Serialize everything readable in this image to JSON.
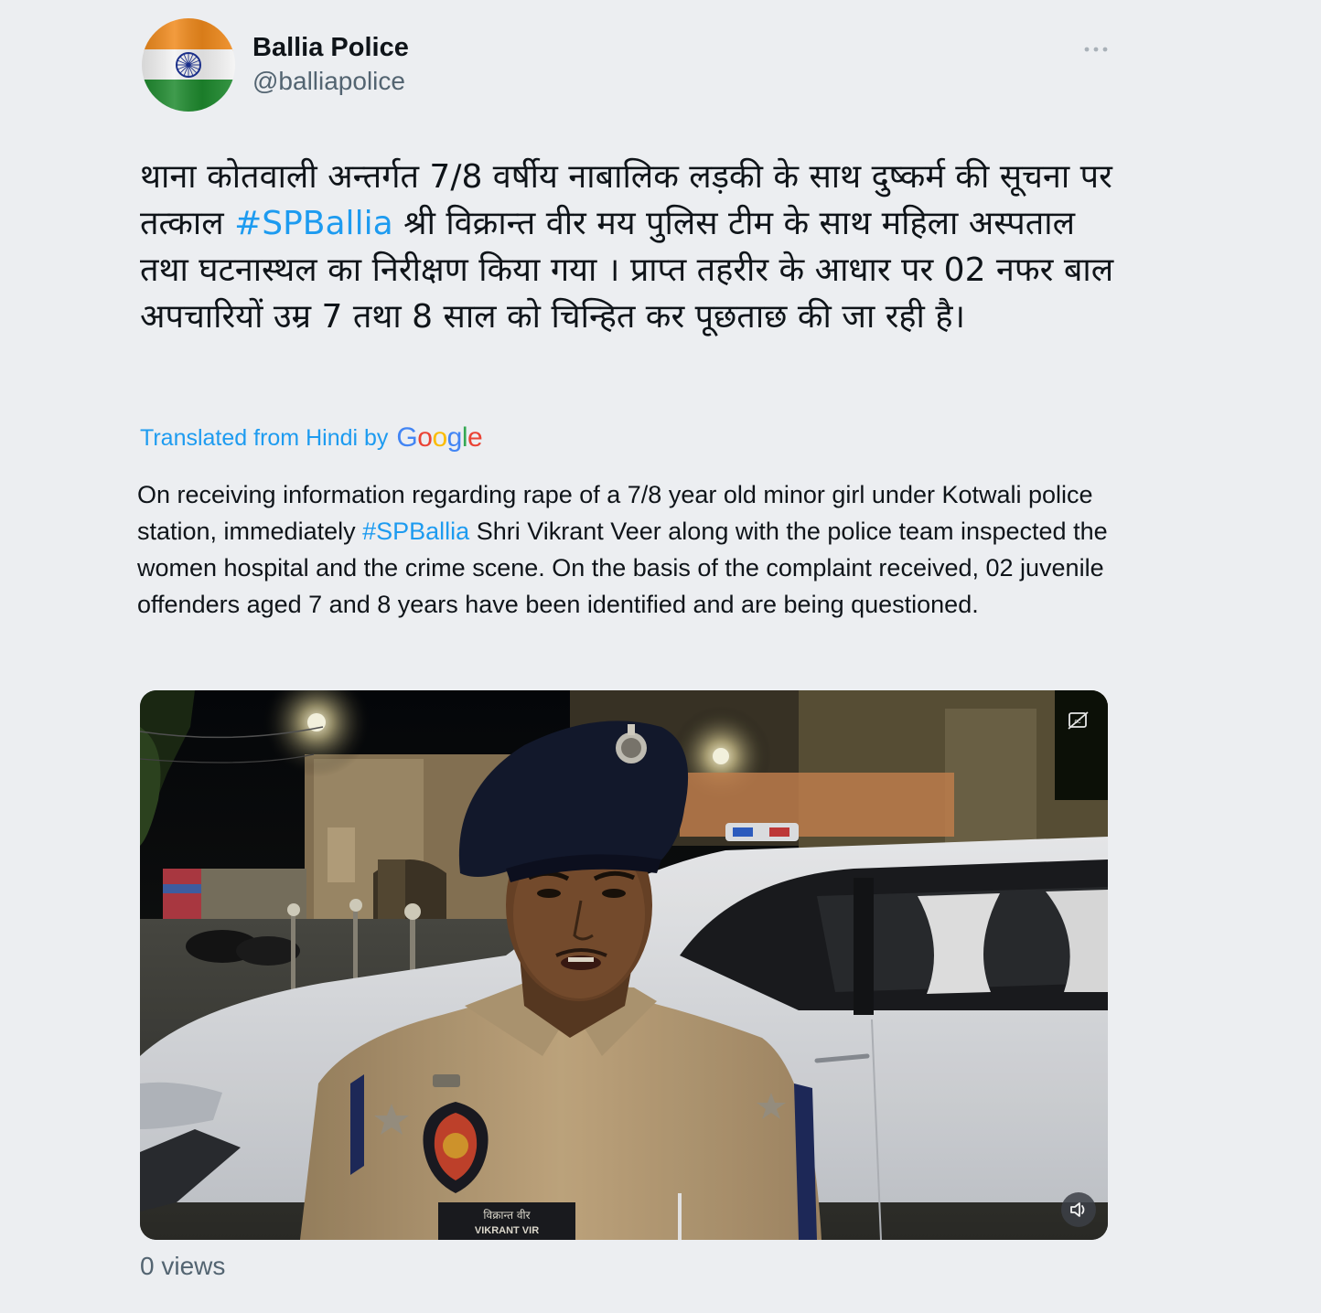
{
  "author": {
    "name": "Ballia Police",
    "handle": "@balliapolice",
    "avatar": "indian-flag-icon"
  },
  "tweet": {
    "hindi_parts": {
      "before_hashtag": "थाना कोतवाली अन्तर्गत 7/8 वर्षीय नाबालिक लड़की के साथ दुष्कर्म की सूचना पर तत्काल ",
      "hashtag": "#SPBallia",
      "after_hashtag": " श्री विक्रान्त वीर मय पुलिस टीम के साथ महिला अस्पताल तथा घटनास्थल का निरीक्षण किया गया । प्राप्त तहरीर के आधार पर 02 नफर बाल अपचारियों  उम्र 7 तथा 8 साल को चिन्हित कर पूछताछ की जा रही है।"
    },
    "translated_label": "Translated from Hindi by",
    "translator_brand": [
      "G",
      "o",
      "o",
      "g",
      "l",
      "e"
    ],
    "english_parts": {
      "before_hashtag": "On receiving information regarding rape of a 7/8 year old minor girl under Kotwali police station, immediately ",
      "hashtag": "#SPBallia",
      "after_hashtag": " Shri Vikrant Veer along with the police team inspected the women hospital and the crime scene. On the basis of the complaint received, 02 juvenile offenders aged 7 and 8 years have been identified and are being questioned."
    },
    "video": {
      "name_tag_hindi": "विक्रान्त वीर",
      "name_tag_english": "VIKRANT VIR",
      "cc_icon": "captions-off-icon",
      "volume_icon": "speaker-muted-icon"
    },
    "views": "0 views"
  },
  "colors": {
    "background": "#eceef1",
    "link": "#1d9bf0",
    "secondary_text": "#536471",
    "google_blue": "#4285f4",
    "google_red": "#ea4335",
    "google_yellow": "#fbbc05",
    "google_green": "#34a853"
  }
}
